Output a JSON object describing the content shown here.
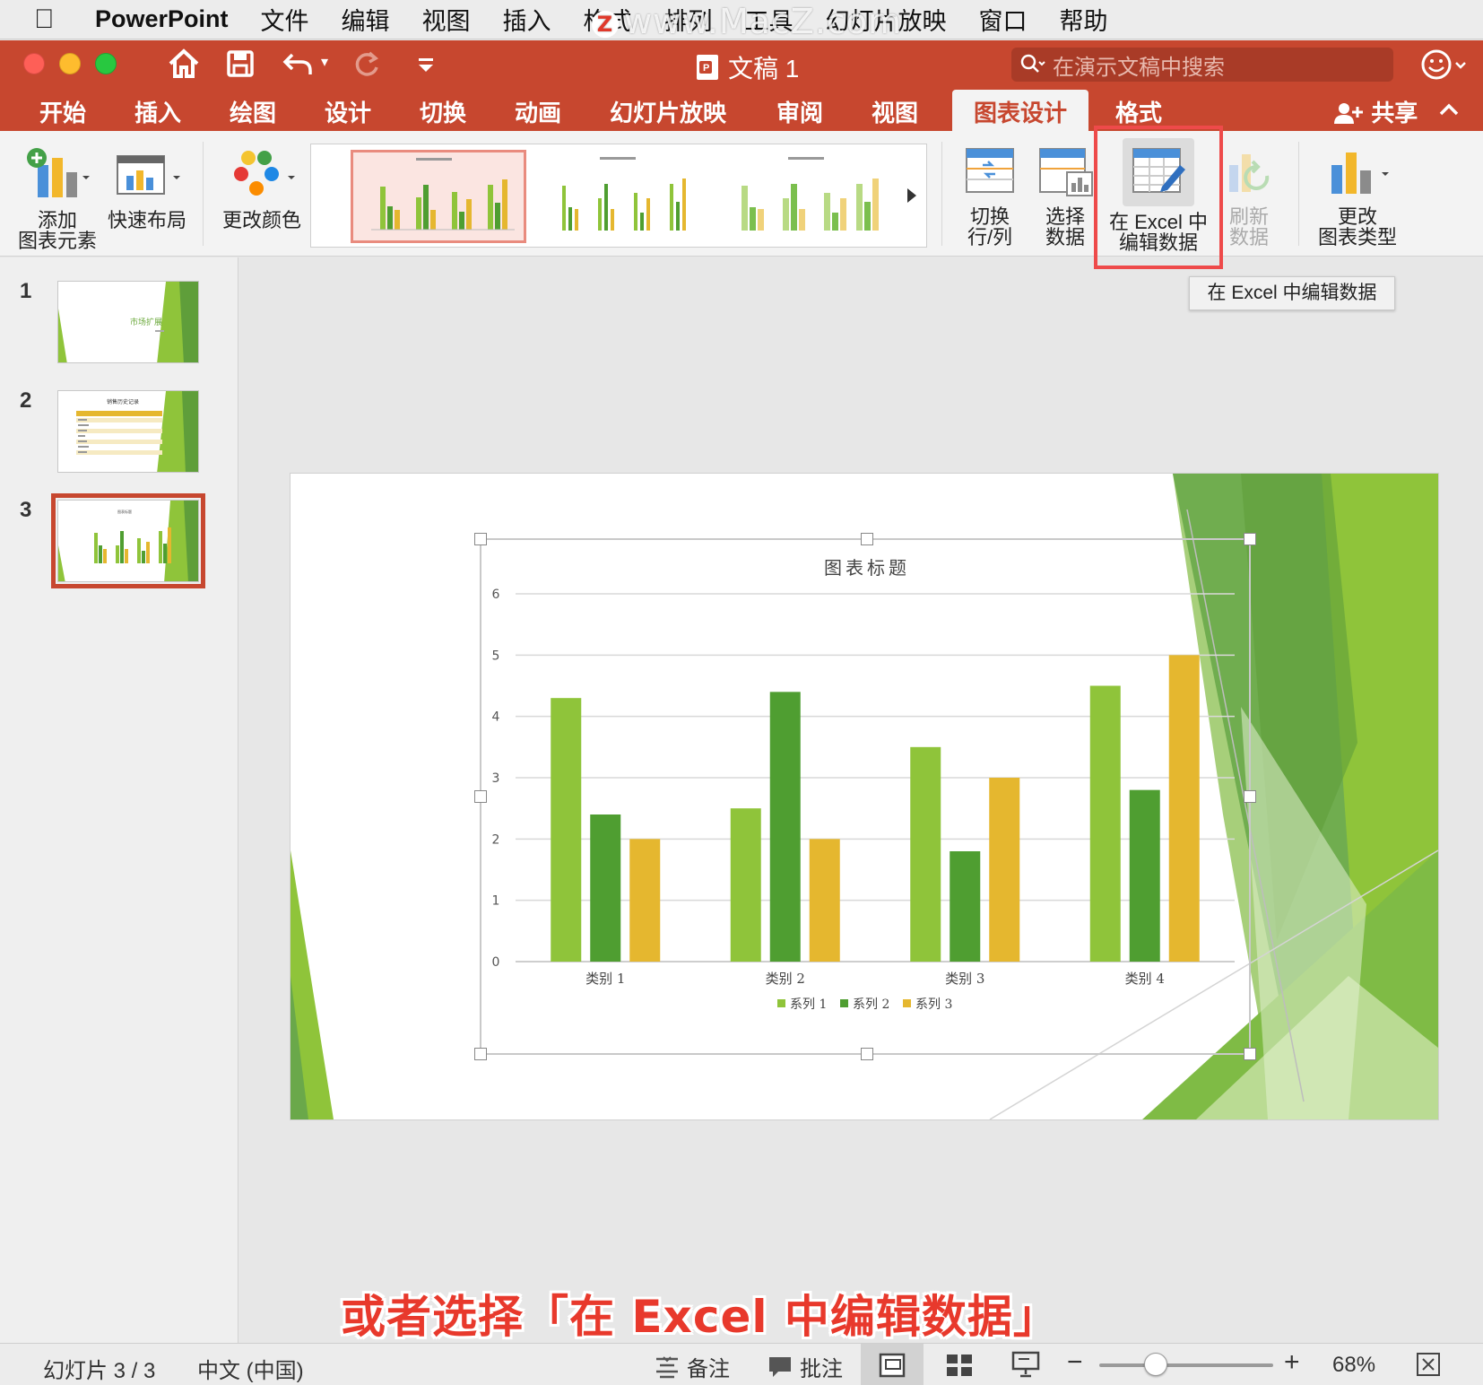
{
  "menubar": {
    "app_name": "PowerPoint",
    "items": [
      "文件",
      "编辑",
      "视图",
      "插入",
      "格式",
      "排列",
      "工具",
      "幻灯片放映",
      "窗口",
      "帮助"
    ],
    "watermark": "www.MacZ.com"
  },
  "window": {
    "title": "文稿 1",
    "search_placeholder": "在演示文稿中搜索"
  },
  "ribbon_tabs": {
    "tabs": [
      "开始",
      "插入",
      "绘图",
      "设计",
      "切换",
      "动画",
      "幻灯片放映",
      "审阅",
      "视图",
      "图表设计",
      "格式"
    ],
    "active": "图表设计",
    "share": "共享"
  },
  "ribbon": {
    "add_element": "添加\n图表元素",
    "quick_layout": "快速布局",
    "change_colors": "更改颜色",
    "switch_row_col": "切换\n行/列",
    "select_data": "选择\n数据",
    "edit_in_excel": "在 Excel 中\n编辑数据",
    "refresh_data": "刷新\n数据",
    "change_type": "更改\n图表类型",
    "tooltip": "在 Excel 中编辑数据"
  },
  "thumbnails": [
    {
      "num": "1",
      "title": "市场扩展"
    },
    {
      "num": "2",
      "title": "销售历史记录"
    },
    {
      "num": "3",
      "title": "图表标题"
    }
  ],
  "chart_data": {
    "type": "bar",
    "title": "图表标题",
    "categories": [
      "类别 1",
      "类别 2",
      "类别 3",
      "类别 4"
    ],
    "series": [
      {
        "name": "系列 1",
        "values": [
          4.3,
          2.5,
          3.5,
          4.5
        ],
        "color": "#8fc43a"
      },
      {
        "name": "系列 2",
        "values": [
          2.4,
          4.4,
          1.8,
          2.8
        ],
        "color": "#4f9e31"
      },
      {
        "name": "系列 3",
        "values": [
          2,
          2,
          3,
          5
        ],
        "color": "#e5b72f"
      }
    ],
    "ylim": [
      0,
      6
    ],
    "yticks": [
      0,
      1,
      2,
      3,
      4,
      5,
      6
    ],
    "grid": true,
    "legend": "bottom"
  },
  "caption": "或者选择「在 Excel 中编辑数据」",
  "status": {
    "slide": "幻灯片 3 / 3",
    "language": "中文 (中国)",
    "notes": "备注",
    "comments": "批注",
    "zoom": "68%"
  },
  "colors": {
    "accent": "#c7472f",
    "highlight": "#ee4a4a"
  }
}
